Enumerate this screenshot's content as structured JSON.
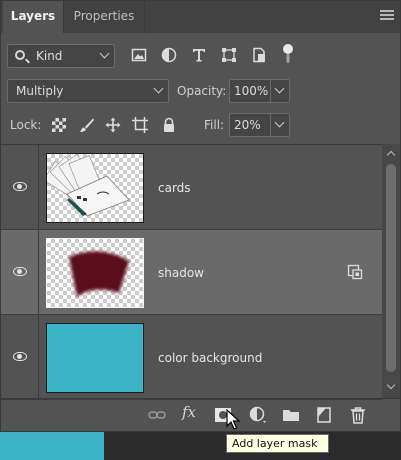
{
  "tabs": [
    {
      "label": "Layers",
      "active": true
    },
    {
      "label": "Properties",
      "active": false
    }
  ],
  "filter": {
    "kind_label": "Kind",
    "icons": [
      "image-filter-icon",
      "adjustment-filter-icon",
      "type-filter-icon",
      "shape-filter-icon",
      "smart-object-filter-icon",
      "filter-toggle-icon"
    ]
  },
  "blend": {
    "mode": "Multiply",
    "opacity_label": "Opacity:",
    "opacity_value": "100%"
  },
  "lock": {
    "label": "Lock:",
    "icons": [
      "lock-transparent-pixels-icon",
      "lock-image-pixels-icon",
      "lock-position-icon",
      "lock-artboard-icon",
      "lock-all-icon"
    ],
    "fill_label": "Fill:",
    "fill_value": "20%"
  },
  "layers": [
    {
      "name": "cards",
      "visible": true,
      "selected": false,
      "thumb": "cards"
    },
    {
      "name": "shadow",
      "visible": true,
      "selected": true,
      "thumb": "shadow"
    },
    {
      "name": "color background",
      "visible": true,
      "selected": false,
      "thumb": "solid"
    }
  ],
  "bottom_toolbar": [
    "link-layers-icon",
    "fx-icon",
    "add-layer-mask-icon",
    "adjustment-layer-icon",
    "new-group-icon",
    "new-layer-icon",
    "delete-layer-icon"
  ],
  "fx_label": "fx",
  "tooltip": "Add layer mask",
  "colors": {
    "panel": "#535353",
    "selected_row": "#6a6a6a",
    "background_fill": "#3cb4c8",
    "shadow_fill": "#5a0a1e"
  }
}
